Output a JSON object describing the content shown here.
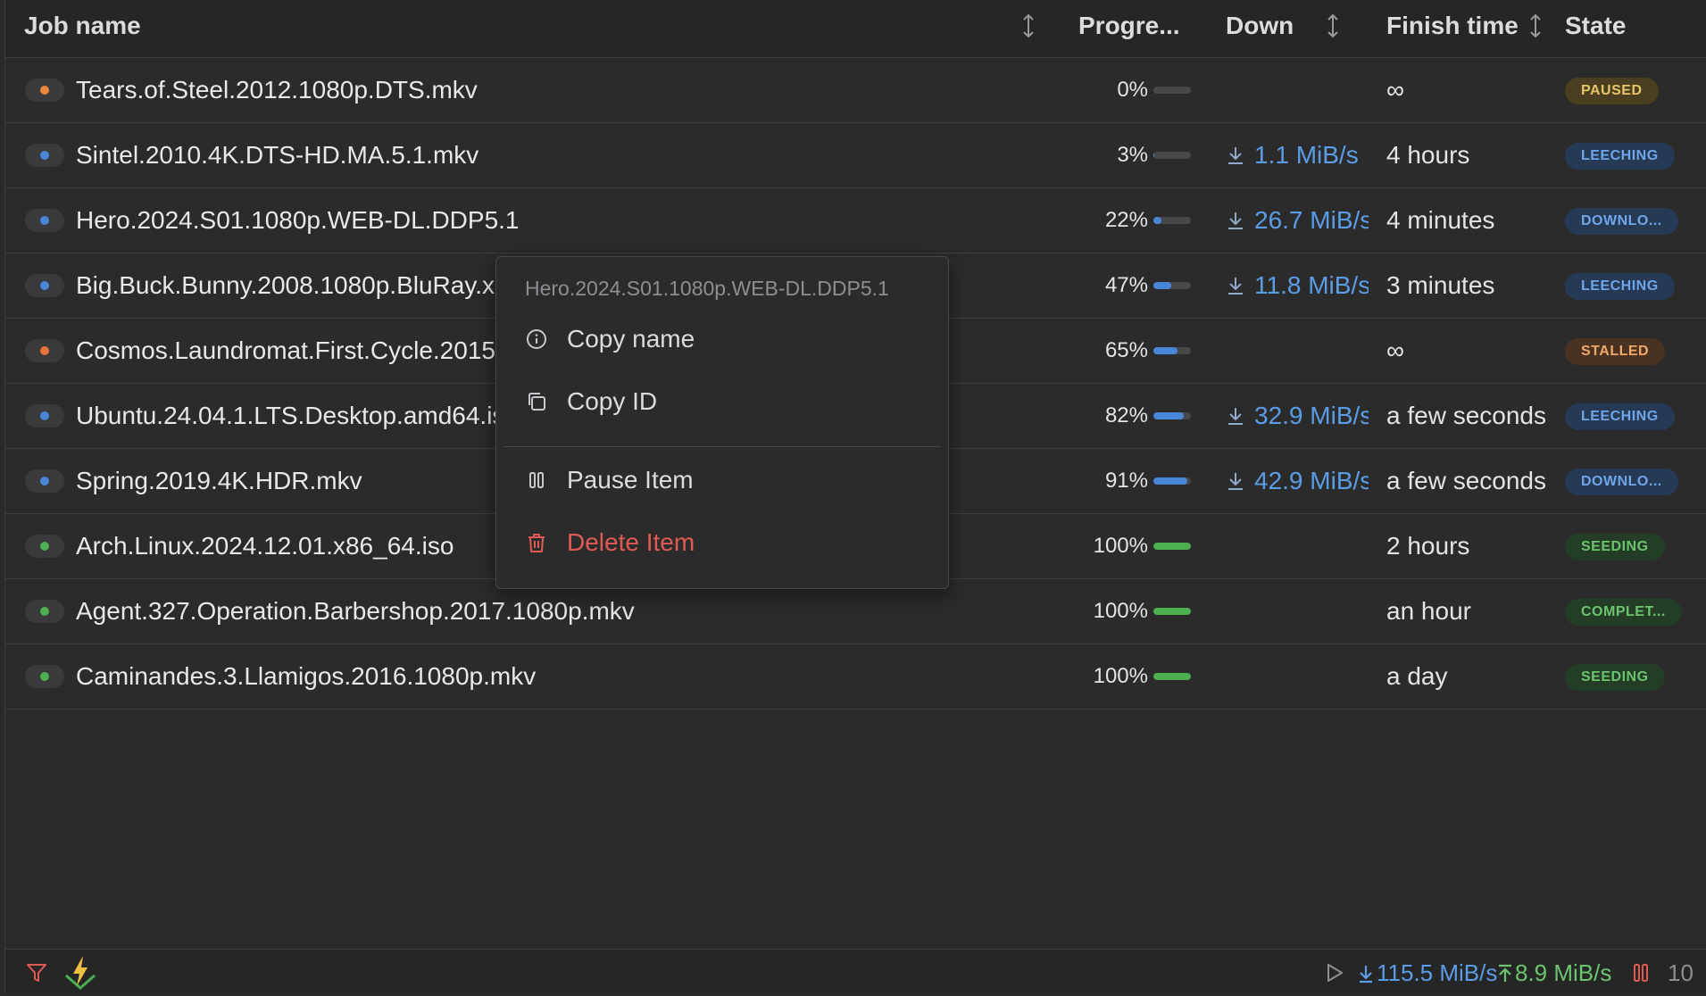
{
  "columns": {
    "job_name": "Job name",
    "progress": "Progre...",
    "down": "Down",
    "finish_time": "Finish time",
    "state": "State"
  },
  "rows": [
    {
      "name": "Tears.of.Steel.2012.1080p.DTS.mkv",
      "dot_color": "#e8873a",
      "progress_label": "0%",
      "progress": 0,
      "down": "",
      "finish": "∞",
      "state": "PAUSED",
      "state_fg": "#e8c56a",
      "state_bg": "#4a3f20"
    },
    {
      "name": "Sintel.2010.4K.DTS-HD.MA.5.1.mkv",
      "dot_color": "#4a86d8",
      "progress_label": "3%",
      "progress": 0.03,
      "down": "1.1 MiB/s",
      "finish": "4 hours",
      "state": "LEECHING",
      "state_fg": "#6fa6e8",
      "state_bg": "#263a55"
    },
    {
      "name": "Hero.2024.S01.1080p.WEB-DL.DDP5.1",
      "dot_color": "#4a86d8",
      "progress_label": "22%",
      "progress": 0.22,
      "down": "26.7 MiB/s",
      "finish": "4 minutes",
      "state": "DOWNLO...",
      "state_fg": "#6fa6e8",
      "state_bg": "#263a55"
    },
    {
      "name": "Big.Buck.Bunny.2008.1080p.BluRay.x264.mkv",
      "dot_color": "#4a86d8",
      "progress_label": "47%",
      "progress": 0.47,
      "down": "11.8 MiB/s",
      "finish": "3 minutes",
      "state": "LEECHING",
      "state_fg": "#6fa6e8",
      "state_bg": "#263a55"
    },
    {
      "name": "Cosmos.Laundromat.First.Cycle.2015.1080p.mkv",
      "dot_color": "#e8733a",
      "progress_label": "65%",
      "progress": 0.65,
      "down": "",
      "finish": "∞",
      "state": "STALLED",
      "state_fg": "#f0a868",
      "state_bg": "#4a3222"
    },
    {
      "name": "Ubuntu.24.04.1.LTS.Desktop.amd64.iso",
      "dot_color": "#4a86d8",
      "progress_label": "82%",
      "progress": 0.82,
      "down": "32.9 MiB/s",
      "finish": "a few seconds",
      "state": "LEECHING",
      "state_fg": "#6fa6e8",
      "state_bg": "#263a55"
    },
    {
      "name": "Spring.2019.4K.HDR.mkv",
      "dot_color": "#4a86d8",
      "progress_label": "91%",
      "progress": 0.91,
      "down": "42.9 MiB/s",
      "finish": "a few seconds",
      "state": "DOWNLO...",
      "state_fg": "#6fa6e8",
      "state_bg": "#263a55"
    },
    {
      "name": "Arch.Linux.2024.12.01.x86_64.iso",
      "dot_color": "#4caf50",
      "progress_label": "100%",
      "progress": 1,
      "down": "",
      "finish": "2 hours",
      "state": "SEEDING",
      "state_fg": "#6cc46e",
      "state_bg": "#233d26"
    },
    {
      "name": "Agent.327.Operation.Barbershop.2017.1080p.mkv",
      "dot_color": "#4caf50",
      "progress_label": "100%",
      "progress": 1,
      "down": "",
      "finish": "an hour",
      "state": "COMPLET...",
      "state_fg": "#6cc46e",
      "state_bg": "#233d26"
    },
    {
      "name": "Caminandes.3.Llamigos.2016.1080p.mkv",
      "dot_color": "#4caf50",
      "progress_label": "100%",
      "progress": 1,
      "down": "",
      "finish": "a day",
      "state": "SEEDING",
      "state_fg": "#6cc46e",
      "state_bg": "#233d26"
    }
  ],
  "context_menu": {
    "title": "Hero.2024.S01.1080p.WEB-DL.DDP5.1",
    "copy_name": "Copy name",
    "copy_id": "Copy ID",
    "pause_item": "Pause Item",
    "delete_item": "Delete Item"
  },
  "footer": {
    "down_speed": "115.5 MiB/s",
    "up_speed": "8.9 MiB/s",
    "count": "10"
  },
  "colors": {
    "accent_blue": "#4a86d8",
    "accent_green": "#4caf50",
    "danger": "#e05a55"
  }
}
